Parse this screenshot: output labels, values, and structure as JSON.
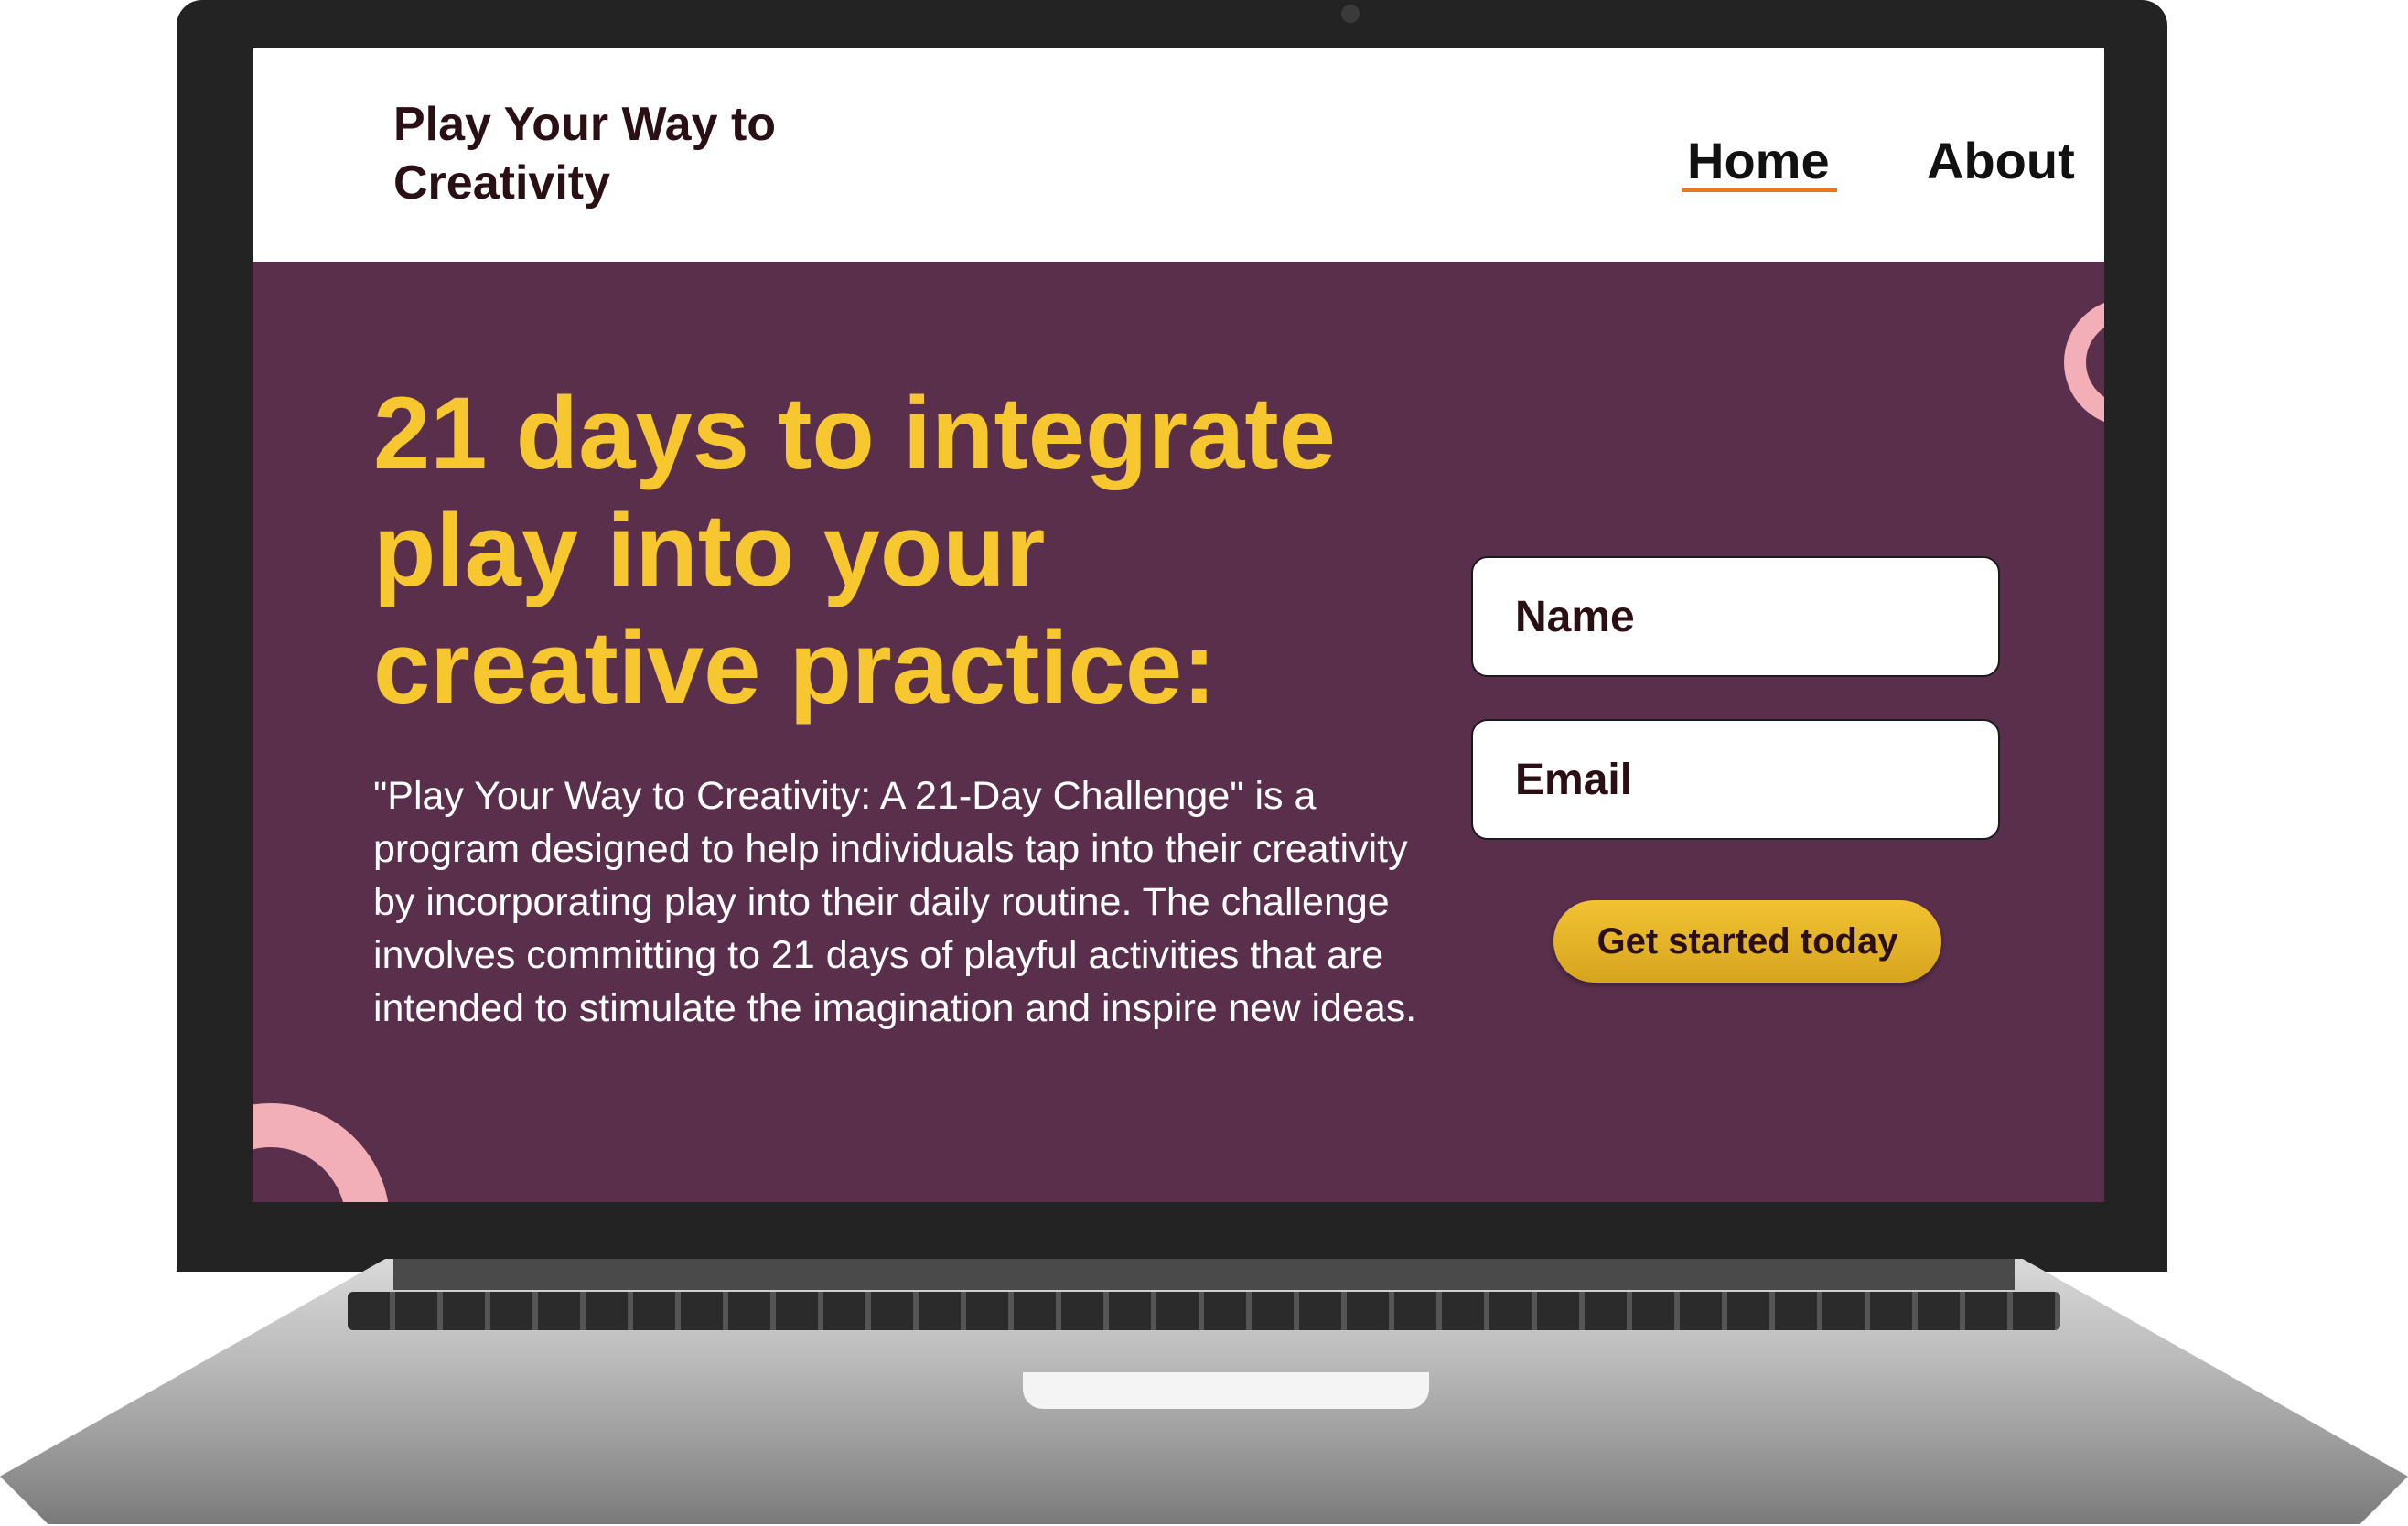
{
  "site": {
    "logo_text": "Play Your Way to Creativity"
  },
  "nav": {
    "home_label": "Home",
    "about_label": "About",
    "active_item": "Home",
    "active_underline_color": "#e87722"
  },
  "hero": {
    "title": "21 days to integrate play into your creative practice:",
    "description": "\"Play Your Way to Creativity: A 21-Day Challenge\" is a program designed to help individuals tap into their creativity by incorporating play into their daily routine. The challenge involves committing to 21 days of playful activities that are intended to stimulate the imagination and inspire new ideas."
  },
  "form": {
    "name_placeholder": "Name",
    "email_placeholder": "Email",
    "submit_label": "Get started today"
  },
  "colors": {
    "hero_background": "#5a2f4c",
    "title_yellow": "#f7c72f",
    "button_yellow": "#f2c233",
    "decoration_pink": "#f2afb8",
    "header_background": "#ffffff"
  }
}
